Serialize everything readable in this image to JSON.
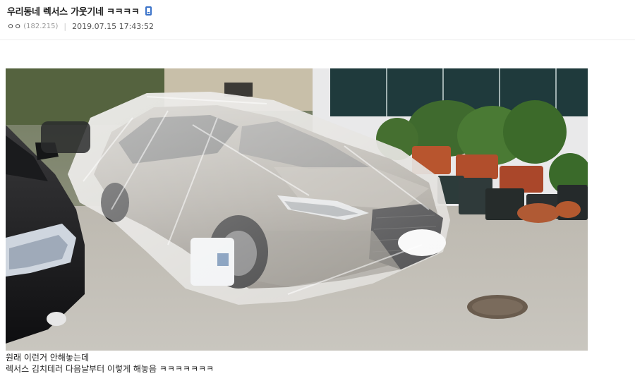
{
  "post": {
    "title": "우리동네 렉서스 가웃기네 ㅋㅋㅋㅋ",
    "author": "ㅇㅇ",
    "author_ip": "(182.215)",
    "separator": "|",
    "date": "2019.07.15 17:43:52",
    "mobile_icon": "mobile-phone-icon"
  },
  "content": {
    "photo_icon": "photo-image",
    "caption_lines": [
      "원래 이런거 안해놓는데",
      "렉서스 김치테러 다음날부터 이렇게 해놓음 ㅋㅋㅋㅋㅋㅋㅋ"
    ]
  },
  "colors": {
    "title": "#1f1f1f",
    "mobile_icon": "#3b73c9",
    "meta_ip": "#999999"
  }
}
